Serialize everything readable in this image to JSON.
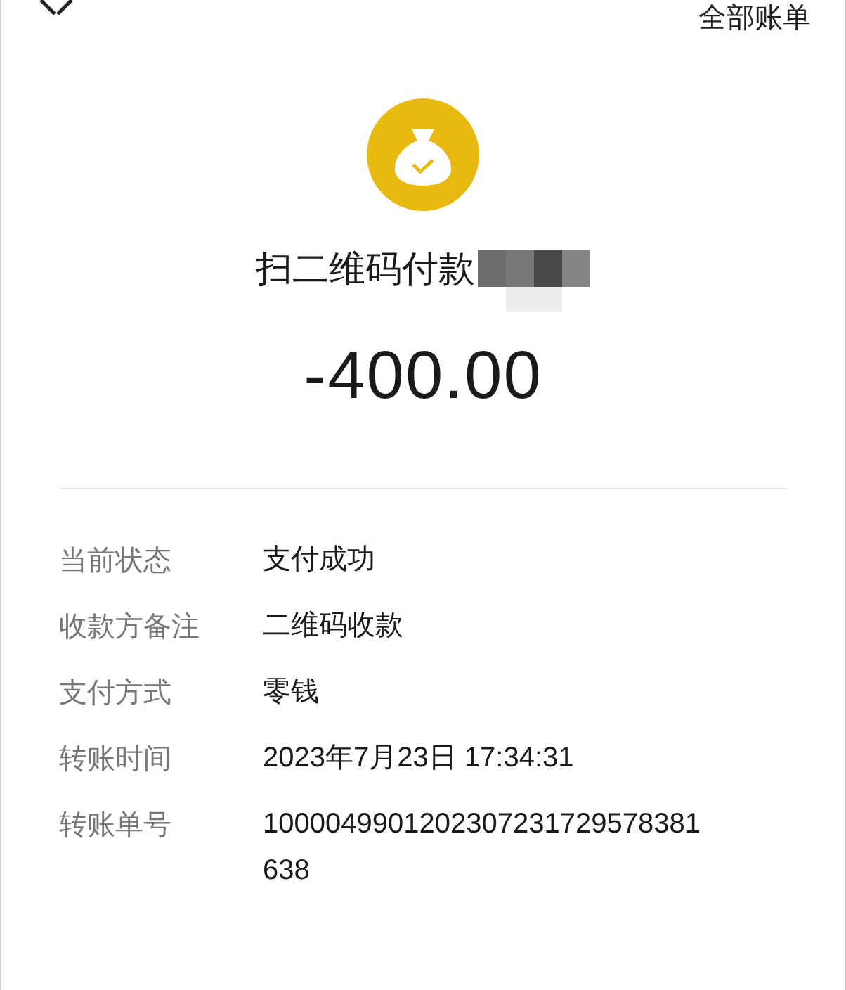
{
  "header": {
    "right_link": "全部账单"
  },
  "title": "扫二维码付款",
  "amount": "-400.00",
  "details": [
    {
      "label": "当前状态",
      "value": "支付成功"
    },
    {
      "label": "收款方备注",
      "value": "二维码收款"
    },
    {
      "label": "支付方式",
      "value": "零钱"
    },
    {
      "label": "转账时间",
      "value": "2023年7月23日 17:34:31"
    },
    {
      "label": "转账单号",
      "value": "1000049901202307231729578381638"
    }
  ]
}
